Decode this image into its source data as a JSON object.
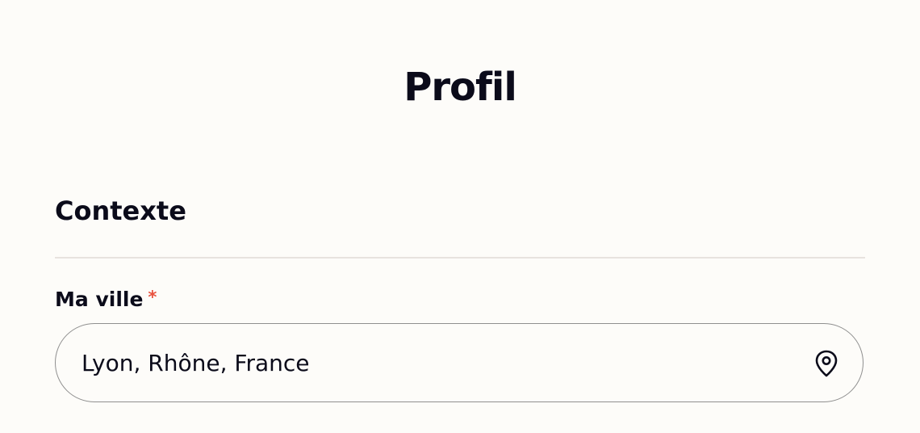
{
  "page": {
    "title": "Profil"
  },
  "section": {
    "title": "Contexte"
  },
  "city_field": {
    "label": "Ma ville",
    "required_marker": "*",
    "value": "Lyon, Rhône, France",
    "icon": "location-pin-icon"
  },
  "colors": {
    "background": "#fdfcf9",
    "text": "#0b0b1a",
    "required": "#e8523f",
    "divider": "#e8e3df",
    "input_border": "#8f8f8f"
  }
}
